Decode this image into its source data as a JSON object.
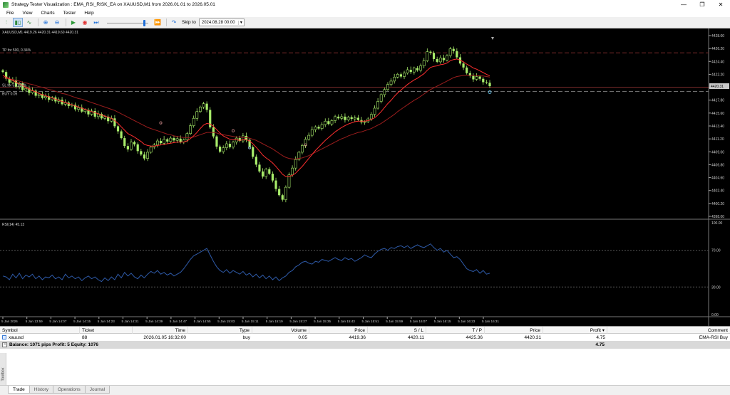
{
  "window": {
    "title": "Strategy Tester Visualization : EMA_RSI_RISK_EA on XAUUSD,M1 from 2026.01.01 to 2026.05.01",
    "buttons": {
      "minimize": "—",
      "restore": "❐",
      "close": "✕"
    }
  },
  "menu": [
    "File",
    "View",
    "Charts",
    "Tester",
    "Help"
  ],
  "toolbar": {
    "skip_label": "Skip to",
    "skip_date": "2024.08.28 00:00",
    "speed_fraction": 0.93
  },
  "chart": {
    "symbol_header": "XAUUSD,M1  4419.26  4420.31  4419.60  4420.31",
    "tp_label": "TP for 500, 0.34%",
    "sl_label": "SL for 5, 0.02%",
    "buy_label": "BUY 0.05",
    "price_tag": "4420.31",
    "rsi_header": "RSI(14) 45.13",
    "colors": {
      "background": "#000000",
      "bull": "#a8ec6a",
      "ema_fast": "#ff2f2f",
      "ema_slow": "#9a1d1d",
      "rsi_line": "#2e5aa8",
      "tp_line": "#7a2b2b",
      "sl_line": "#6d6d6d"
    },
    "price_ticks": [
      "4428.00",
      "4426.20",
      "4424.40",
      "4422.20",
      "4420.31",
      "4417.80",
      "4415.60",
      "4413.40",
      "4411.20",
      "4409.00",
      "4406.80",
      "4404.60",
      "4402.40",
      "4400.20",
      "4398.00"
    ],
    "rsi_ticks": [
      "100.00",
      "70.00",
      "30.00",
      "0.00"
    ],
    "time_labels": [
      "5 Jan 2026",
      "5 Jan 13:59",
      "5 Jan 14:07",
      "5 Jan 14:15",
      "5 Jan 14:23",
      "5 Jan 14:31",
      "5 Jan 14:39",
      "5 Jan 14:47",
      "5 Jan 14:55",
      "5 Jan 15:03",
      "5 Jan 15:11",
      "5 Jan 15:19",
      "5 Jan 15:27",
      "5 Jan 15:35",
      "5 Jan 15:43",
      "5 Jan 15:51",
      "5 Jan 15:59",
      "5 Jan 16:07",
      "5 Jan 16:15",
      "5 Jan 16:23",
      "5 Jan 16:31"
    ]
  },
  "chart_data": {
    "type": "candlestick",
    "price_range": [
      4397.0,
      4429.5
    ],
    "rsi_range": [
      0,
      100
    ],
    "close": [
      4422.8,
      4421.6,
      4420.9,
      4421.4,
      4420.2,
      4420.8,
      4419.6,
      4419.9,
      4419.1,
      4419.5,
      4418.6,
      4418.9,
      4418.2,
      4418.5,
      4417.9,
      4418.3,
      4417.6,
      4417.9,
      4417.1,
      4417.4,
      4416.8,
      4417.0,
      4416.2,
      4416.5,
      4415.8,
      4416.1,
      4415.3,
      4415.9,
      4414.9,
      4415.4,
      4414.6,
      4414.9,
      4414.1,
      4414.6,
      4413.2,
      4412.3,
      4411.1,
      4409.7,
      4409.1,
      4410.4,
      4410.0,
      4408.8,
      4408.2,
      4407.5,
      4408.6,
      4409.5,
      4409.9,
      4410.6,
      4410.2,
      4410.9,
      4410.5,
      4411.1,
      4410.7,
      4411.0,
      4410.4,
      4410.8,
      4411.9,
      4413.3,
      4414.6,
      4415.8,
      4416.6,
      4417.2,
      4416.1,
      4413.0,
      4411.4,
      4409.6,
      4408.7,
      4409.4,
      4410.1,
      4409.5,
      4410.4,
      4411.1,
      4410.6,
      4411.5,
      4410.8,
      4409.5,
      4407.8,
      4406.4,
      4405.2,
      4404.3,
      4405.6,
      4404.8,
      4403.6,
      4402.1,
      4401.0,
      4400.2,
      4402.4,
      4404.6,
      4405.8,
      4407.3,
      4408.6,
      4409.8,
      4410.9,
      4411.6,
      4412.6,
      4413.1,
      4412.8,
      4413.5,
      4414.1,
      4413.6,
      4414.2,
      4414.9,
      4414.6,
      4414.9,
      4414.3,
      4414.8,
      4414.5,
      4414.7,
      4414.3,
      4413.9,
      4414.0,
      4414.5,
      4415.3,
      4416.4,
      4417.6,
      4418.8,
      4419.7,
      4420.6,
      4421.2,
      4421.9,
      4422.4,
      4422.0,
      4422.6,
      4423.2,
      4422.8,
      4423.5,
      4423.1,
      4423.9,
      4424.8,
      4426.4,
      4426.2,
      4425.1,
      4424.6,
      4425.3,
      4424.9,
      4425.7,
      4426.9,
      4426.5,
      4425.4,
      4424.3,
      4423.6,
      4422.6,
      4422.1,
      4421.5,
      4422.0,
      4421.6,
      4421.0,
      4420.9,
      4420.3
    ],
    "ema_fast": [
      4422.2,
      4421.9,
      4421.6,
      4421.3,
      4421.0,
      4420.7,
      4420.4,
      4420.1,
      4419.8,
      4419.5,
      4419.3,
      4419.0,
      4418.8,
      4418.6,
      4418.4,
      4418.2,
      4418.0,
      4417.8,
      4417.6,
      4417.4,
      4417.2,
      4417.0,
      4416.8,
      4416.6,
      4416.4,
      4416.2,
      4416.0,
      4415.8,
      4415.6,
      4415.4,
      4415.2,
      4415.0,
      4414.8,
      4414.6,
      4414.2,
      4413.7,
      4413.1,
      4412.5,
      4411.9,
      4411.6,
      4411.3,
      4410.9,
      4410.5,
      4410.0,
      4409.8,
      4409.7,
      4409.7,
      4409.8,
      4409.9,
      4410.0,
      4410.1,
      4410.2,
      4410.3,
      4410.4,
      4410.4,
      4410.4,
      4410.6,
      4411.0,
      4411.5,
      4412.1,
      4412.8,
      4413.4,
      4413.7,
      4413.6,
      4413.2,
      4412.6,
      4412.0,
      4411.5,
      4411.2,
      4410.9,
      4410.8,
      4410.8,
      4410.7,
      4410.8,
      4410.8,
      4410.6,
      4410.1,
      4409.5,
      4408.8,
      4408.1,
      4407.6,
      4407.2,
      4406.7,
      4406.1,
      4405.4,
      4404.7,
      4404.3,
      4404.3,
      4404.5,
      4404.9,
      4405.5,
      4406.1,
      4406.8,
      4407.5,
      4408.2,
      4408.9,
      4409.5,
      4410.1,
      4410.7,
      4411.2,
      4411.7,
      4412.2,
      4412.6,
      4413.0,
      4413.3,
      4413.6,
      4413.8,
      4414.0,
      4414.1,
      4414.1,
      4414.1,
      4414.2,
      4414.4,
      4414.7,
      4415.2,
      4415.8,
      4416.5,
      4417.2,
      4417.8,
      4418.5,
      4419.1,
      4419.6,
      4420.1,
      4420.6,
      4421.0,
      4421.4,
      4421.7,
      4422.1,
      4422.5,
      4423.1,
      4423.6,
      4423.8,
      4423.9,
      4424.1,
      4424.2,
      4424.4,
      4424.8,
      4425.0,
      4425.1,
      4424.9,
      4424.6,
      4424.2,
      4423.9,
      4423.5,
      4423.3,
      4423.0,
      4422.7,
      4422.4,
      4422.1
    ],
    "ema_slow": [
      4421.8,
      4421.7,
      4421.6,
      4421.5,
      4421.3,
      4421.2,
      4421.0,
      4420.9,
      4420.7,
      4420.6,
      4420.4,
      4420.2,
      4420.1,
      4419.9,
      4419.7,
      4419.6,
      4419.4,
      4419.2,
      4419.0,
      4418.9,
      4418.7,
      4418.5,
      4418.3,
      4418.1,
      4418.0,
      4417.8,
      4417.6,
      4417.4,
      4417.2,
      4417.0,
      4416.8,
      4416.6,
      4416.4,
      4416.2,
      4416.0,
      4415.7,
      4415.4,
      4415.1,
      4414.8,
      4414.5,
      4414.2,
      4413.9,
      4413.6,
      4413.3,
      4413.0,
      4412.8,
      4412.6,
      4412.4,
      4412.2,
      4412.0,
      4411.8,
      4411.7,
      4411.5,
      4411.4,
      4411.3,
      4411.2,
      4411.2,
      4411.2,
      4411.3,
      4411.5,
      4411.7,
      4411.9,
      4412.1,
      4412.1,
      4412.1,
      4412.0,
      4411.8,
      4411.7,
      4411.6,
      4411.5,
      4411.4,
      4411.3,
      4411.3,
      4411.2,
      4411.2,
      4411.1,
      4410.9,
      4410.7,
      4410.4,
      4410.1,
      4409.8,
      4409.5,
      4409.2,
      4408.8,
      4408.4,
      4408.0,
      4407.7,
      4407.5,
      4407.4,
      4407.4,
      4407.5,
      4407.6,
      4407.8,
      4408.0,
      4408.3,
      4408.6,
      4408.9,
      4409.2,
      4409.5,
      4409.8,
      4410.1,
      4410.4,
      4410.7,
      4411.0,
      4411.2,
      4411.5,
      4411.7,
      4411.9,
      4412.1,
      4412.2,
      4412.4,
      4412.6,
      4412.8,
      4413.1,
      4413.4,
      4413.7,
      4414.1,
      4414.5,
      4414.9,
      4415.3,
      4415.8,
      4416.2,
      4416.6,
      4417.0,
      4417.4,
      4417.8,
      4418.1,
      4418.5,
      4418.9,
      4419.3,
      4419.7,
      4420.0,
      4420.3,
      4420.6,
      4420.9,
      4421.2,
      4421.5,
      4421.8,
      4422.0,
      4422.1,
      4422.2,
      4422.2,
      4422.2,
      4422.2,
      4422.2,
      4422.1,
      4422.1,
      4422.0,
      4421.9
    ],
    "rsi": [
      42,
      41,
      38,
      44,
      40,
      45,
      39,
      43,
      41,
      44,
      39,
      42,
      38,
      41,
      40,
      43,
      39,
      41,
      38,
      44,
      40,
      42,
      39,
      41,
      37,
      40,
      42,
      39,
      41,
      38,
      36,
      40,
      37,
      41,
      38,
      44,
      40,
      46,
      42,
      45,
      41,
      39,
      43,
      40,
      44,
      47,
      45,
      48,
      44,
      46,
      43,
      45,
      42,
      44,
      46,
      50,
      55,
      60,
      64,
      66,
      68,
      70,
      72,
      65,
      58,
      52,
      48,
      46,
      49,
      45,
      48,
      46,
      44,
      47,
      43,
      45,
      41,
      44,
      40,
      43,
      39,
      42,
      38,
      41,
      37,
      40,
      42,
      46,
      48,
      52,
      54,
      57,
      58,
      56,
      55,
      58,
      57,
      60,
      59,
      58,
      60,
      62,
      60,
      59,
      62,
      60,
      61,
      58,
      60,
      62,
      65,
      63,
      62,
      66,
      69,
      71,
      72,
      70,
      73,
      72,
      74,
      75,
      73,
      75,
      72,
      74,
      76,
      74,
      73,
      75,
      77,
      73,
      70,
      72,
      68,
      70,
      66,
      62,
      63,
      60,
      55,
      50,
      48,
      47,
      49,
      45,
      48,
      44,
      45
    ],
    "tp_price": 4426.2,
    "sl_price": 4420.11,
    "entry_price": 4419.36
  },
  "grid": {
    "headers": {
      "symbol": "Symbol",
      "ticket": "Ticket",
      "time": "Time",
      "type": "Type",
      "volume": "Volume",
      "price": "Price",
      "sl": "S / L",
      "tp": "T / P",
      "current": "Price",
      "profit": "Profit ▾",
      "comment": "Comment"
    },
    "row": {
      "symbol": "xauusd",
      "ticket": "88",
      "time": "2026.01.05 16:32:00",
      "type": "buy",
      "volume": "0.05",
      "price": "4419.36",
      "sl": "4420.11",
      "tp": "4425.36",
      "current": "4420.31",
      "profit": "4.75",
      "comment": "EMA-RSI Buy"
    },
    "balance": {
      "text": "Balance: 1071 pips   Profit: 5   Equity: 1076",
      "profit": "4.75"
    }
  },
  "tabs": [
    "Trade",
    "History",
    "Operations",
    "Journal"
  ],
  "side_label": "Toolbox"
}
